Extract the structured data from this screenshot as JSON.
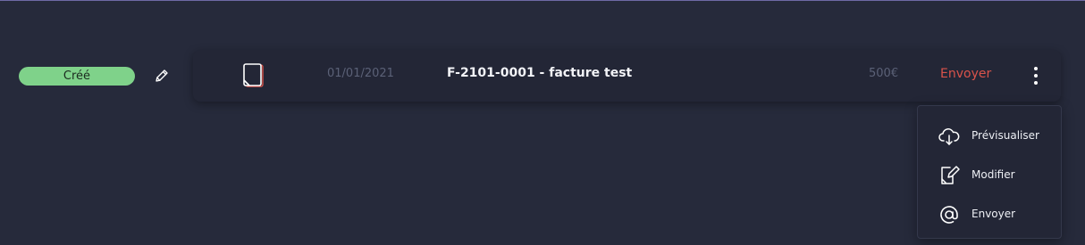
{
  "invoice_row": {
    "status": "Créé",
    "date": "01/01/2021",
    "title": "F-2101-0001 - facture test",
    "amount": "500€",
    "send_label": "Envoyer"
  },
  "dropdown": {
    "items": [
      {
        "label": "Prévisualiser",
        "icon": "cloud-download-icon"
      },
      {
        "label": "Modifier",
        "icon": "edit-document-icon"
      },
      {
        "label": "Envoyer",
        "icon": "at-sign-icon"
      }
    ]
  },
  "colors": {
    "background": "#262a3b",
    "card": "#232636",
    "status_badge": "#7fd28a",
    "send_red": "#d9534b",
    "muted_text": "#5b6177"
  }
}
